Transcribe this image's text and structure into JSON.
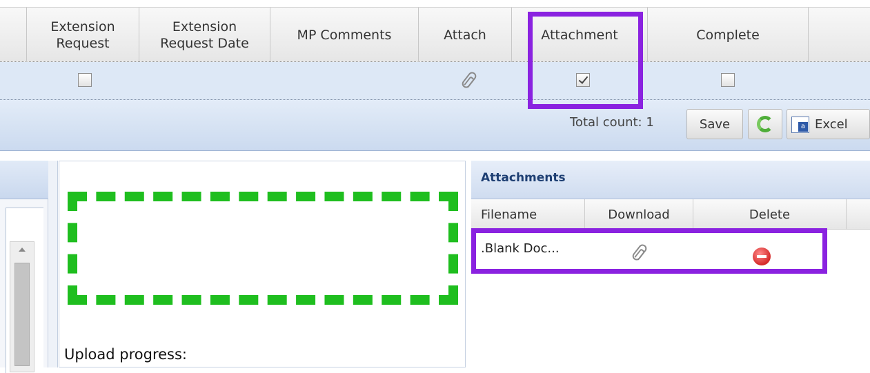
{
  "grid": {
    "columns": [
      {
        "label": "Extension\nRequest"
      },
      {
        "label": "Extension\nRequest Date"
      },
      {
        "label": "MP Comments"
      },
      {
        "label": "Attach"
      },
      {
        "label": "Attachment"
      },
      {
        "label": "Complete"
      }
    ],
    "row": {
      "extension_request_checked": false,
      "attach_icon": "paperclip-icon",
      "attachment_checked": true,
      "complete_checked": false
    }
  },
  "toolbar": {
    "total_count": "Total count: 1",
    "save_label": "Save",
    "refresh_icon": "refresh-icon",
    "excel_label": "Excel",
    "excel_icon": "excel-icon"
  },
  "upload": {
    "progress_label": "Upload progress:"
  },
  "attachments": {
    "title": "Attachments",
    "columns": [
      "Filename",
      "Download",
      "Delete"
    ],
    "rows": [
      {
        "filename": ".Blank Doc...",
        "download_icon": "paperclip-icon",
        "delete_icon": "delete-icon"
      }
    ]
  },
  "highlights": {
    "annotation_color": "#8a22e0",
    "dropzone_color": "#1fbe1f"
  }
}
